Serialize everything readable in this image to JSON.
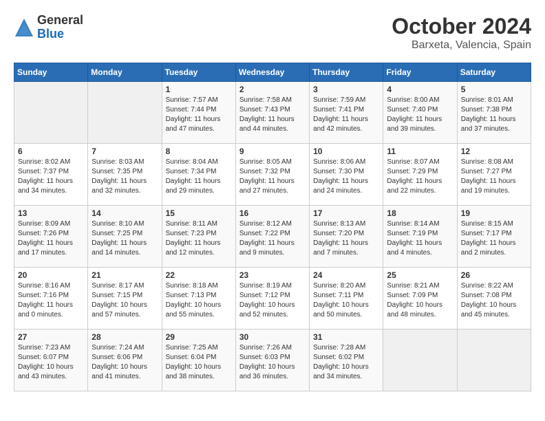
{
  "header": {
    "logo_general": "General",
    "logo_blue": "Blue",
    "month_title": "October 2024",
    "location": "Barxeta, Valencia, Spain"
  },
  "columns": [
    "Sunday",
    "Monday",
    "Tuesday",
    "Wednesday",
    "Thursday",
    "Friday",
    "Saturday"
  ],
  "weeks": [
    [
      {
        "day": "",
        "info": ""
      },
      {
        "day": "",
        "info": ""
      },
      {
        "day": "1",
        "info": "Sunrise: 7:57 AM\nSunset: 7:44 PM\nDaylight: 11 hours and 47 minutes."
      },
      {
        "day": "2",
        "info": "Sunrise: 7:58 AM\nSunset: 7:43 PM\nDaylight: 11 hours and 44 minutes."
      },
      {
        "day": "3",
        "info": "Sunrise: 7:59 AM\nSunset: 7:41 PM\nDaylight: 11 hours and 42 minutes."
      },
      {
        "day": "4",
        "info": "Sunrise: 8:00 AM\nSunset: 7:40 PM\nDaylight: 11 hours and 39 minutes."
      },
      {
        "day": "5",
        "info": "Sunrise: 8:01 AM\nSunset: 7:38 PM\nDaylight: 11 hours and 37 minutes."
      }
    ],
    [
      {
        "day": "6",
        "info": "Sunrise: 8:02 AM\nSunset: 7:37 PM\nDaylight: 11 hours and 34 minutes."
      },
      {
        "day": "7",
        "info": "Sunrise: 8:03 AM\nSunset: 7:35 PM\nDaylight: 11 hours and 32 minutes."
      },
      {
        "day": "8",
        "info": "Sunrise: 8:04 AM\nSunset: 7:34 PM\nDaylight: 11 hours and 29 minutes."
      },
      {
        "day": "9",
        "info": "Sunrise: 8:05 AM\nSunset: 7:32 PM\nDaylight: 11 hours and 27 minutes."
      },
      {
        "day": "10",
        "info": "Sunrise: 8:06 AM\nSunset: 7:30 PM\nDaylight: 11 hours and 24 minutes."
      },
      {
        "day": "11",
        "info": "Sunrise: 8:07 AM\nSunset: 7:29 PM\nDaylight: 11 hours and 22 minutes."
      },
      {
        "day": "12",
        "info": "Sunrise: 8:08 AM\nSunset: 7:27 PM\nDaylight: 11 hours and 19 minutes."
      }
    ],
    [
      {
        "day": "13",
        "info": "Sunrise: 8:09 AM\nSunset: 7:26 PM\nDaylight: 11 hours and 17 minutes."
      },
      {
        "day": "14",
        "info": "Sunrise: 8:10 AM\nSunset: 7:25 PM\nDaylight: 11 hours and 14 minutes."
      },
      {
        "day": "15",
        "info": "Sunrise: 8:11 AM\nSunset: 7:23 PM\nDaylight: 11 hours and 12 minutes."
      },
      {
        "day": "16",
        "info": "Sunrise: 8:12 AM\nSunset: 7:22 PM\nDaylight: 11 hours and 9 minutes."
      },
      {
        "day": "17",
        "info": "Sunrise: 8:13 AM\nSunset: 7:20 PM\nDaylight: 11 hours and 7 minutes."
      },
      {
        "day": "18",
        "info": "Sunrise: 8:14 AM\nSunset: 7:19 PM\nDaylight: 11 hours and 4 minutes."
      },
      {
        "day": "19",
        "info": "Sunrise: 8:15 AM\nSunset: 7:17 PM\nDaylight: 11 hours and 2 minutes."
      }
    ],
    [
      {
        "day": "20",
        "info": "Sunrise: 8:16 AM\nSunset: 7:16 PM\nDaylight: 11 hours and 0 minutes."
      },
      {
        "day": "21",
        "info": "Sunrise: 8:17 AM\nSunset: 7:15 PM\nDaylight: 10 hours and 57 minutes."
      },
      {
        "day": "22",
        "info": "Sunrise: 8:18 AM\nSunset: 7:13 PM\nDaylight: 10 hours and 55 minutes."
      },
      {
        "day": "23",
        "info": "Sunrise: 8:19 AM\nSunset: 7:12 PM\nDaylight: 10 hours and 52 minutes."
      },
      {
        "day": "24",
        "info": "Sunrise: 8:20 AM\nSunset: 7:11 PM\nDaylight: 10 hours and 50 minutes."
      },
      {
        "day": "25",
        "info": "Sunrise: 8:21 AM\nSunset: 7:09 PM\nDaylight: 10 hours and 48 minutes."
      },
      {
        "day": "26",
        "info": "Sunrise: 8:22 AM\nSunset: 7:08 PM\nDaylight: 10 hours and 45 minutes."
      }
    ],
    [
      {
        "day": "27",
        "info": "Sunrise: 7:23 AM\nSunset: 6:07 PM\nDaylight: 10 hours and 43 minutes."
      },
      {
        "day": "28",
        "info": "Sunrise: 7:24 AM\nSunset: 6:06 PM\nDaylight: 10 hours and 41 minutes."
      },
      {
        "day": "29",
        "info": "Sunrise: 7:25 AM\nSunset: 6:04 PM\nDaylight: 10 hours and 38 minutes."
      },
      {
        "day": "30",
        "info": "Sunrise: 7:26 AM\nSunset: 6:03 PM\nDaylight: 10 hours and 36 minutes."
      },
      {
        "day": "31",
        "info": "Sunrise: 7:28 AM\nSunset: 6:02 PM\nDaylight: 10 hours and 34 minutes."
      },
      {
        "day": "",
        "info": ""
      },
      {
        "day": "",
        "info": ""
      }
    ]
  ]
}
